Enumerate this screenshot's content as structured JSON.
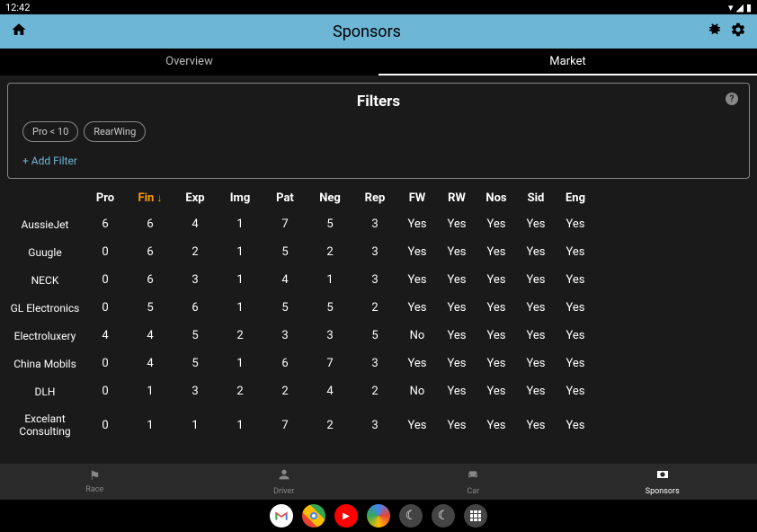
{
  "status_bar": {
    "time": "12:42"
  },
  "app_bar": {
    "title": "Sponsors"
  },
  "tabs": {
    "overview": "Overview",
    "market": "Market"
  },
  "filters": {
    "title": "Filters",
    "chips": [
      "Pro < 10",
      "RearWing"
    ],
    "add_label": "+ Add Filter"
  },
  "table": {
    "headers": [
      "Pro",
      "Fin",
      "Exp",
      "Img",
      "Pat",
      "Neg",
      "Rep",
      "FW",
      "RW",
      "Nos",
      "Sid",
      "Eng"
    ],
    "sort_col": "Fin",
    "rows": [
      {
        "name": "AussieJet",
        "vals": [
          "6",
          "6",
          "4",
          "1",
          "7",
          "5",
          "3",
          "Yes",
          "Yes",
          "Yes",
          "Yes",
          "Yes"
        ]
      },
      {
        "name": "Guugle",
        "vals": [
          "0",
          "6",
          "2",
          "1",
          "5",
          "2",
          "3",
          "Yes",
          "Yes",
          "Yes",
          "Yes",
          "Yes"
        ]
      },
      {
        "name": "NECK",
        "vals": [
          "0",
          "6",
          "3",
          "1",
          "4",
          "1",
          "3",
          "Yes",
          "Yes",
          "Yes",
          "Yes",
          "Yes"
        ]
      },
      {
        "name": "GL Electronics",
        "vals": [
          "0",
          "5",
          "6",
          "1",
          "5",
          "5",
          "2",
          "Yes",
          "Yes",
          "Yes",
          "Yes",
          "Yes"
        ]
      },
      {
        "name": "Electroluxery",
        "vals": [
          "4",
          "4",
          "5",
          "2",
          "3",
          "3",
          "5",
          "No",
          "Yes",
          "Yes",
          "Yes",
          "Yes"
        ]
      },
      {
        "name": "China Mobils",
        "vals": [
          "0",
          "4",
          "5",
          "1",
          "6",
          "7",
          "3",
          "Yes",
          "Yes",
          "Yes",
          "Yes",
          "Yes"
        ]
      },
      {
        "name": "DLH",
        "vals": [
          "0",
          "1",
          "3",
          "2",
          "2",
          "4",
          "2",
          "No",
          "Yes",
          "Yes",
          "Yes",
          "Yes"
        ]
      },
      {
        "name": "Excelant Consulting",
        "vals": [
          "0",
          "1",
          "1",
          "1",
          "7",
          "2",
          "3",
          "Yes",
          "Yes",
          "Yes",
          "Yes",
          "Yes"
        ]
      }
    ]
  },
  "bottom_nav": {
    "race": "Race",
    "driver": "Driver",
    "car": "Car",
    "sponsors": "Sponsors"
  }
}
